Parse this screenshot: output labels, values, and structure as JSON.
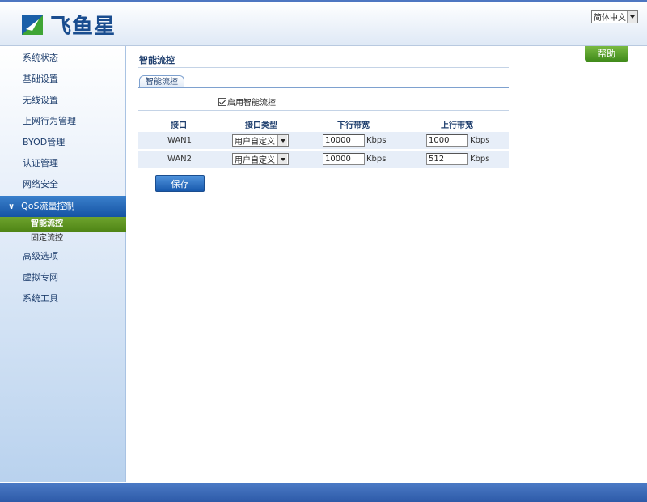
{
  "header": {
    "brand": "飞鱼星",
    "language": "简体中文",
    "colors": {
      "brand": "#1a4d8f",
      "accent": "#2d5aa8"
    }
  },
  "help_label": "帮助",
  "sidebar": {
    "items": [
      {
        "label": "系统状态"
      },
      {
        "label": "基础设置"
      },
      {
        "label": "无线设置"
      },
      {
        "label": "上网行为管理"
      },
      {
        "label": "BYOD管理"
      },
      {
        "label": "认证管理"
      },
      {
        "label": "网络安全"
      },
      {
        "label": "QoS流量控制",
        "active": true
      },
      {
        "label": "高级选项"
      },
      {
        "label": "虚拟专网"
      },
      {
        "label": "系统工具"
      }
    ],
    "subitems": [
      {
        "label": "智能流控",
        "active": true
      },
      {
        "label": "固定流控"
      }
    ]
  },
  "main": {
    "title": "智能流控",
    "tab": "智能流控",
    "enable": {
      "label": "启用智能流控",
      "checked": true
    },
    "table": {
      "headers": [
        "接口",
        "接口类型",
        "下行带宽",
        "上行带宽"
      ],
      "rows": [
        {
          "iface": "WAN1",
          "type": "用户自定义",
          "down": "10000",
          "down_unit": "Kbps",
          "up": "1000",
          "up_unit": "Kbps"
        },
        {
          "iface": "WAN2",
          "type": "用户自定义",
          "down": "10000",
          "down_unit": "Kbps",
          "up": "512",
          "up_unit": "Kbps"
        }
      ]
    },
    "save_label": "保存"
  }
}
